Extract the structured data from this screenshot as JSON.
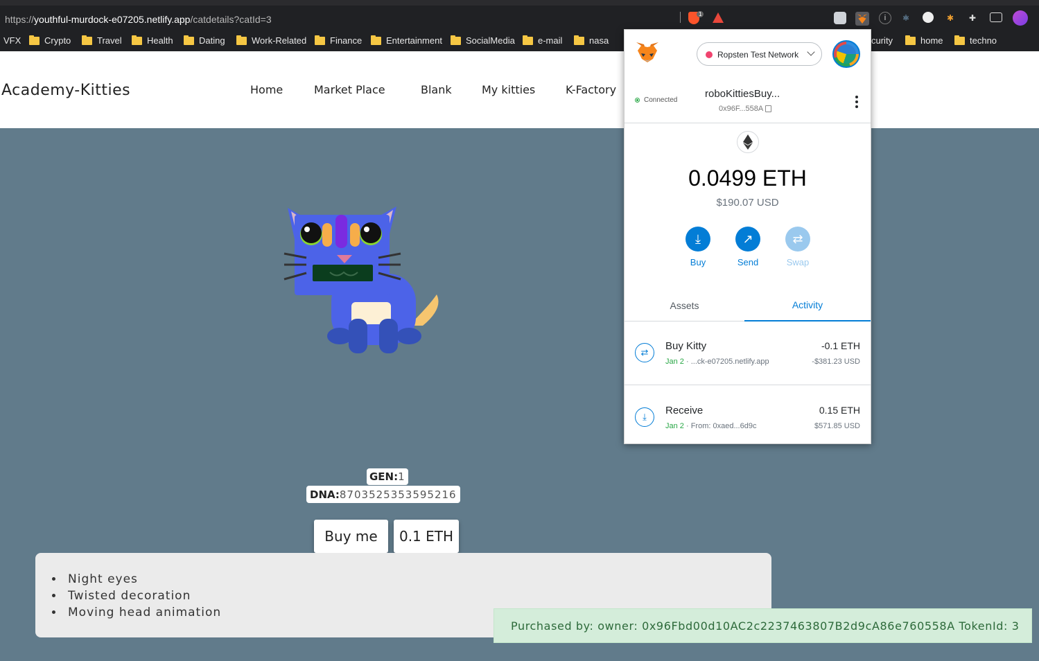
{
  "browser": {
    "url_prefix": "https://",
    "url_host": "youthful-murdock-e07205.netlify.app",
    "url_path": "/catdetails?catId=3",
    "brave_badge": "1"
  },
  "bookmarks": [
    {
      "label": "VFX",
      "folder": false
    },
    {
      "label": "Crypto",
      "folder": true
    },
    {
      "label": "Travel",
      "folder": true
    },
    {
      "label": "Health",
      "folder": true
    },
    {
      "label": "Dating",
      "folder": true
    },
    {
      "label": "Work-Related",
      "folder": true
    },
    {
      "label": "Finance",
      "folder": true
    },
    {
      "label": "Entertainment",
      "folder": true
    },
    {
      "label": "SocialMedia",
      "folder": true
    },
    {
      "label": "e-mail",
      "folder": true
    },
    {
      "label": "nasa",
      "folder": true
    },
    {
      "label": "curity",
      "folder": false
    },
    {
      "label": "home",
      "folder": true
    },
    {
      "label": "techno",
      "folder": true
    }
  ],
  "site": {
    "brand": "Academy-Kitties",
    "nav": [
      "Home",
      "Market Place",
      "Blank",
      "My kitties",
      "K-Factory"
    ]
  },
  "cat": {
    "gen_label": "GEN:",
    "gen_value": "1",
    "dna_label": "DNA:",
    "dna_value": "8703525353595216",
    "buy_label": "Buy me",
    "price_label": "0.1 ETH",
    "attributes": [
      "Night eyes",
      "Twisted decoration",
      "Moving head animation"
    ],
    "colors": {
      "body": "#4c63e8",
      "ear_inner": "#d9b6c8",
      "mouth": "#0b3d1e",
      "tail": "#f6c56f",
      "belly": "#fdf0d5",
      "feet": "#3451b8"
    }
  },
  "toast": "Purchased by: owner: 0x96Fbd00d10AC2c2237463807B2d9cA86e760558A TokenId: 3",
  "metamask": {
    "network": "Ropsten Test Network",
    "connected": "Connected",
    "account_name": "roboKittiesBuy...",
    "account_address": "0x96F...558A",
    "balance": "0.0499 ETH",
    "balance_usd": "$190.07 USD",
    "actions": [
      "Buy",
      "Send",
      "Swap"
    ],
    "tabs": [
      "Assets",
      "Activity"
    ],
    "active_tab": "Activity",
    "transactions": [
      {
        "title": "Buy Kitty",
        "date": "Jan 2",
        "detail": "...ck-e07205.netlify.app",
        "amount": "-0.1 ETH",
        "fiat": "-$381.23 USD",
        "icon": "swap-icon"
      },
      {
        "title": "Receive",
        "date": "Jan 2",
        "detail": "From: 0xaed...6d9c",
        "amount": "0.15 ETH",
        "fiat": "$571.85 USD",
        "icon": "receive-icon"
      }
    ]
  }
}
